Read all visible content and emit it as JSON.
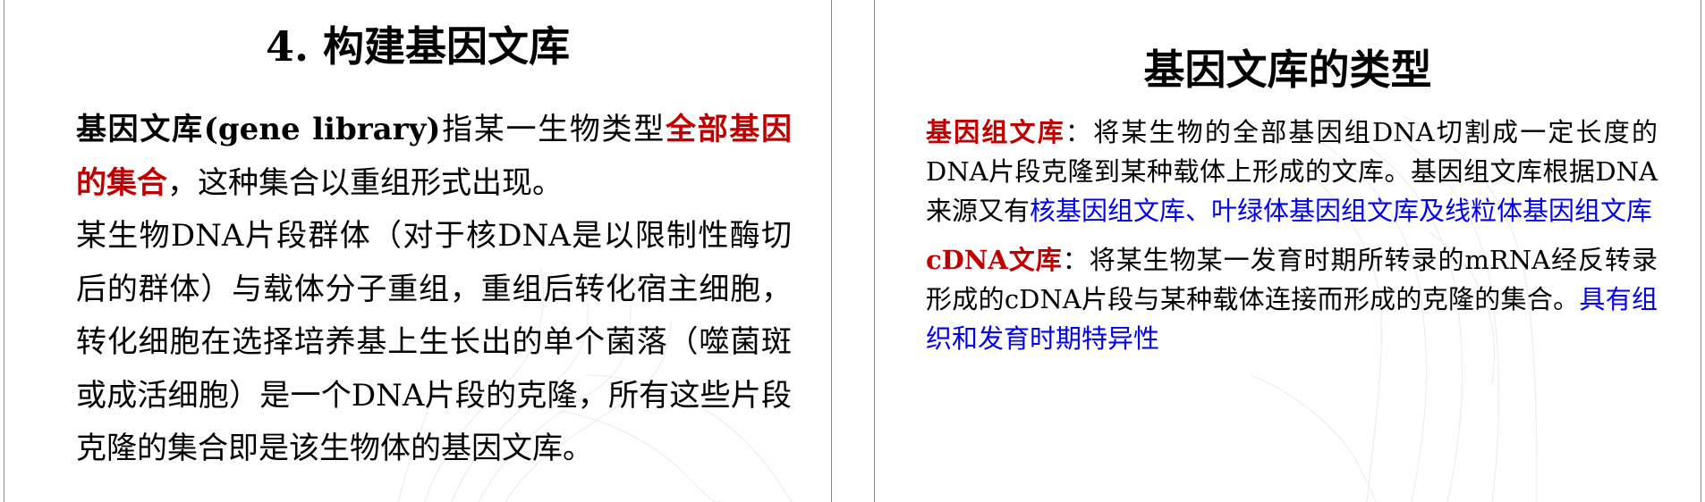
{
  "left_slide": {
    "title": "4. 构建基因文库",
    "para1": {
      "term": "基因文库(gene library)",
      "text1": "指某一生物类型",
      "highlight": "全部基因的集合",
      "text2": "，这种集合以重组形式出现。"
    },
    "para2": "某生物DNA片段群体（对于核DNA是以限制性酶切后的群体）与载体分子重组，重组后转化宿主细胞，转化细胞在选择培养基上生长出的单个菌落（噬菌斑或成活细胞）是一个DNA片段的克隆，所有这些片段克隆的集合即是该生物体的基因文库。"
  },
  "right_slide": {
    "title": "基因文库的类型",
    "genomic": {
      "term": "基因组文库",
      "text": "：将某生物的全部基因组DNA切割成一定长度的DNA片段克隆到某种载体上形成的文库。基因组文库根据DNA来源又有",
      "highlight": "核基因组文库、叶绿体基因组文库及线粒体基因组文库"
    },
    "cdna": {
      "term": "cDNA文库",
      "text": "：将某生物某一发育时期所转录的mRNA经反转录形成的cDNA片段与某种载体连接而形成的克隆的集合。",
      "highlight": "具有组织和发育时期特异性"
    }
  },
  "colors": {
    "highlight_red": "#c00000",
    "highlight_blue": "#0000ee",
    "slide_border": "#8c8c8c"
  }
}
